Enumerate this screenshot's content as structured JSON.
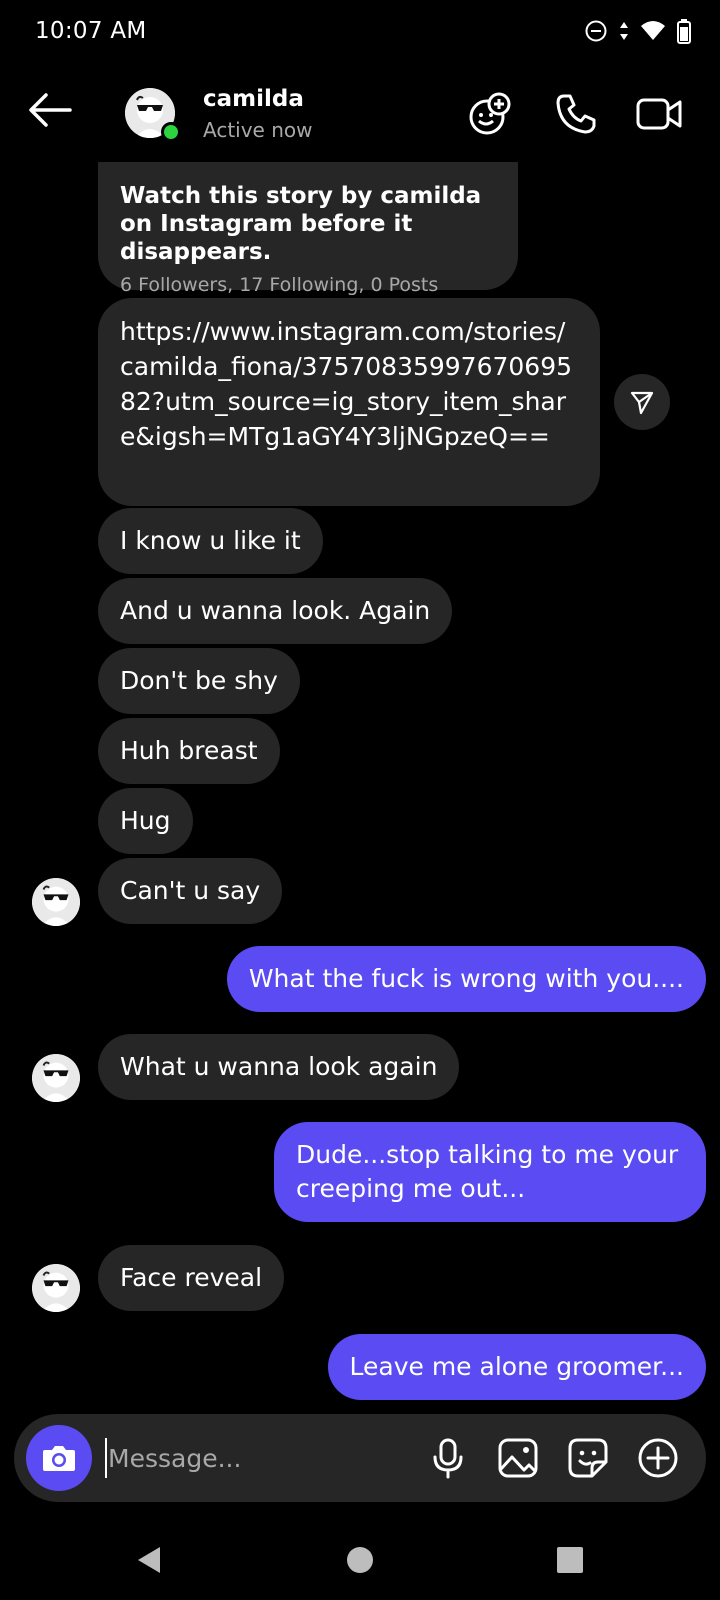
{
  "status_bar": {
    "time": "10:07 AM",
    "icons": [
      "do-not-disturb-icon",
      "data-arrows-icon",
      "wifi-icon",
      "battery-icon"
    ]
  },
  "header": {
    "name": "camilda",
    "status": "Active now",
    "icons": [
      "back-arrow-icon",
      "effects-icon",
      "phone-icon",
      "video-icon"
    ]
  },
  "story_card": {
    "title": "Watch this story by camilda on Instagram before it disappears.",
    "meta": "6 Followers, 17 Following, 0 Posts"
  },
  "messages": [
    {
      "type": "incoming",
      "text": "https://www.instagram.com/stories/camilda_fiona/3757083599767069582?utm_source=ig_story_item_share&igsh=MTg1aGY4Y3ljNGpzeQ=="
    },
    {
      "type": "incoming",
      "text": "I know u like it"
    },
    {
      "type": "incoming",
      "text": "And u wanna look. Again"
    },
    {
      "type": "incoming",
      "text": "Don't be shy"
    },
    {
      "type": "incoming",
      "text": "Huh breast"
    },
    {
      "type": "incoming",
      "text": "Hug"
    },
    {
      "type": "incoming",
      "text": "Can't u say"
    },
    {
      "type": "outgoing",
      "text": "What the fuck is wrong with you...."
    },
    {
      "type": "incoming",
      "text": "What u wanna look again"
    },
    {
      "type": "outgoing",
      "text": "Dude...stop talking to me your creeping me out..."
    },
    {
      "type": "incoming",
      "text": "Face reveal"
    },
    {
      "type": "outgoing",
      "text": "Leave me alone groomer..."
    }
  ],
  "composer": {
    "placeholder": "Message...",
    "icons": [
      "camera-icon",
      "microphone-icon",
      "gallery-icon",
      "sticker-icon",
      "plus-icon"
    ]
  },
  "nav_bar": {
    "icons": [
      "back-triangle-icon",
      "home-circle-icon",
      "recents-square-icon"
    ]
  },
  "colors": {
    "background": "#000000",
    "incoming_bubble": "#262626",
    "outgoing_bubble": "#5b4bf2",
    "online": "#2cd440",
    "secondary_text": "#a8a8a8"
  }
}
